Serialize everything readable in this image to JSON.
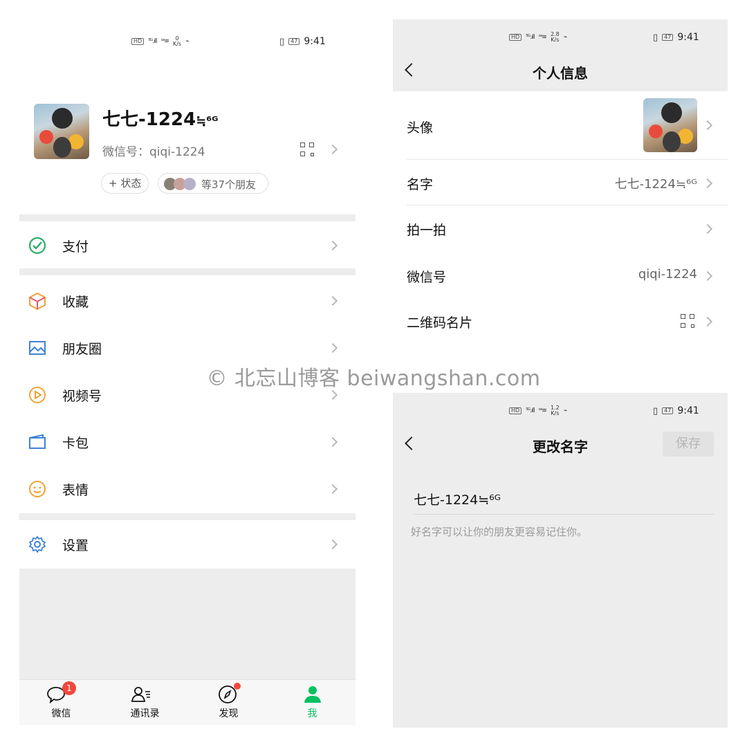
{
  "status_bar": {
    "left_icons": [
      "HD",
      "5G",
      "signal",
      "wifi"
    ],
    "speeds": [
      "0\nK/s",
      "2.8\nK/s",
      "1.2\nK/s"
    ],
    "battery": "47",
    "time": "9:41"
  },
  "me_page": {
    "profile": {
      "name": "七七-1224",
      "name_suffix": "≒⁶ᴳ",
      "wechat_id_label": "微信号：qiqi-1224",
      "status_button": "+ 状态",
      "friends_text": "等37个朋友"
    },
    "menu": [
      {
        "label": "支付",
        "icon": "pay-icon",
        "color": "#2aae67"
      },
      {
        "label": "收藏",
        "icon": "favorites-cube-icon",
        "color": "#f0b23a"
      },
      {
        "label": "朋友圈",
        "icon": "moments-image-icon",
        "color": "#3d83d8"
      },
      {
        "label": "视频号",
        "icon": "channels-play-icon",
        "color": "#f0a233"
      },
      {
        "label": "卡包",
        "icon": "card-wallet-icon",
        "color": "#3d83d8"
      },
      {
        "label": "表情",
        "icon": "emoji-smile-icon",
        "color": "#f0a233"
      },
      {
        "label": "设置",
        "icon": "settings-gear-icon",
        "color": "#3d83d8"
      }
    ],
    "tabbar": [
      {
        "label": "微信",
        "icon": "chat-bubble-icon",
        "badge": "1"
      },
      {
        "label": "通讯录",
        "icon": "contacts-icon"
      },
      {
        "label": "发现",
        "icon": "compass-icon"
      },
      {
        "label": "我",
        "icon": "person-icon"
      }
    ],
    "accent_color": "#07c160"
  },
  "profile_info_page": {
    "title": "个人信息",
    "rows": [
      {
        "label": "头像",
        "value": ""
      },
      {
        "label": "名字",
        "value": "七七-1224≒⁶ᴳ"
      },
      {
        "label": "拍一拍",
        "value": ""
      },
      {
        "label": "微信号",
        "value": "qiqi-1224"
      },
      {
        "label": "二维码名片",
        "value": ""
      }
    ]
  },
  "edit_name_page": {
    "title": "更改名字",
    "save_button": "保存",
    "name_value": "七七-1224≒⁶ᴳ",
    "hint": "好名字可以让你的朋友更容易记住你。"
  },
  "watermark": "© 北忘山博客 beiwangshan.com"
}
